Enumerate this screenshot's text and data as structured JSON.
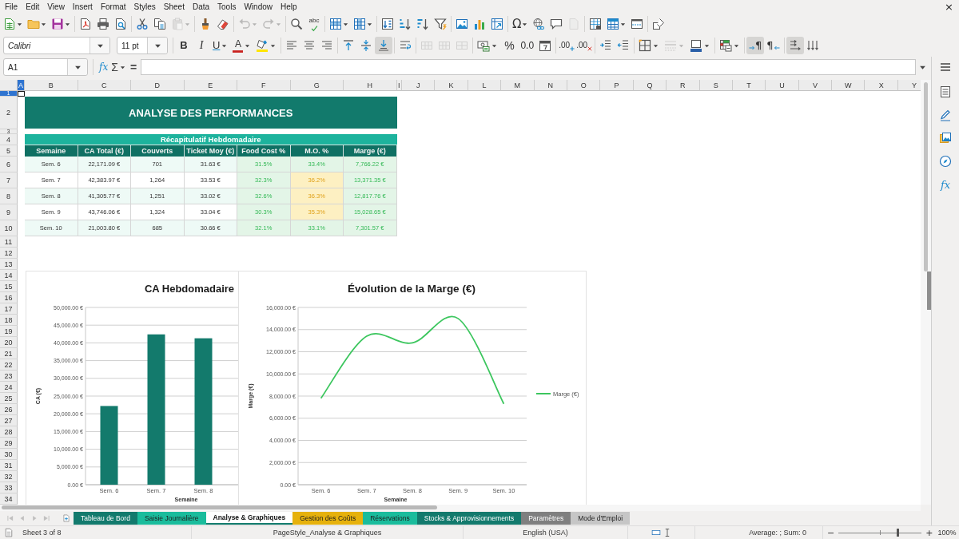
{
  "menu_bar": {
    "items": [
      "File",
      "Edit",
      "View",
      "Insert",
      "Format",
      "Styles",
      "Sheet",
      "Data",
      "Tools",
      "Window",
      "Help"
    ],
    "close_button": "×"
  },
  "standard_toolbar": {
    "groups": [
      [
        {
          "dropdown": true,
          "disabled": false
        },
        {
          "dropdown": true,
          "disabled": false
        },
        {
          "dropdown": true,
          "disabled": false
        }
      ],
      [
        {
          "dropdown": false,
          "disabled": false
        },
        {
          "dropdown": false,
          "disabled": false
        },
        {
          "dropdown": false,
          "disabled": false
        }
      ],
      [
        {
          "dropdown": false,
          "disabled": false
        },
        {
          "dropdown": false,
          "disabled": false
        },
        {
          "dropdown": true,
          "disabled": true
        }
      ],
      [
        {
          "dropdown": false,
          "disabled": false
        },
        {
          "dropdown": false,
          "disabled": false
        }
      ],
      [
        {
          "dropdown": true,
          "disabled": true
        },
        {
          "dropdown": true,
          "disabled": true
        }
      ],
      [
        {
          "dropdown": false,
          "disabled": false
        },
        {
          "label": "abc",
          "dropdown": false,
          "disabled": false
        }
      ],
      [
        {
          "dropdown": true,
          "disabled": false
        },
        {
          "dropdown": true,
          "disabled": false
        }
      ],
      [
        {
          "dropdown": false,
          "disabled": false
        },
        {
          "dropdown": false,
          "disabled": false
        },
        {
          "dropdown": false,
          "disabled": false
        },
        {
          "dropdown": false,
          "disabled": false
        }
      ],
      [
        {
          "dropdown": false,
          "disabled": false
        },
        {
          "dropdown": false,
          "disabled": false
        },
        {
          "dropdown": false,
          "disabled": false
        }
      ],
      [
        {
          "label": "Ω",
          "dropdown": true,
          "disabled": false
        },
        {
          "dropdown": false,
          "disabled": false
        },
        {
          "dropdown": false,
          "disabled": false
        },
        {
          "dropdown": false,
          "disabled": true
        }
      ],
      [
        {
          "dropdown": false,
          "disabled": false
        },
        {
          "dropdown": true,
          "disabled": false
        },
        {
          "dropdown": false,
          "disabled": false
        }
      ],
      [
        {
          "dropdown": false,
          "disabled": false
        }
      ]
    ]
  },
  "formatting_toolbar": {
    "font_name": "Calibri",
    "font_size": "11 pt",
    "groups": [
      [
        {
          "label": "B",
          "dropdown": false,
          "disabled": false,
          "pressed": false
        },
        {
          "label": "I",
          "dropdown": false,
          "disabled": false,
          "pressed": false
        },
        {
          "label": "U",
          "dropdown": true,
          "disabled": false,
          "pressed": false
        },
        {
          "label": "A",
          "dropdown": true,
          "disabled": false,
          "pressed": false
        },
        {
          "dropdown": true,
          "disabled": false,
          "pressed": false
        }
      ],
      [
        {
          "dropdown": false,
          "disabled": false,
          "pressed": false
        },
        {
          "dropdown": false,
          "disabled": false,
          "pressed": false
        },
        {
          "dropdown": false,
          "disabled": false,
          "pressed": false
        }
      ],
      [
        {
          "dropdown": false,
          "disabled": false,
          "pressed": false
        },
        {
          "dropdown": false,
          "disabled": false,
          "pressed": false
        },
        {
          "dropdown": false,
          "disabled": false,
          "pressed": true
        }
      ],
      [
        {
          "dropdown": false,
          "disabled": false,
          "pressed": false
        }
      ],
      [
        {
          "dropdown": false,
          "disabled": true,
          "pressed": false
        },
        {
          "dropdown": false,
          "disabled": true,
          "pressed": false
        },
        {
          "dropdown": false,
          "disabled": true,
          "pressed": false
        }
      ],
      [
        {
          "dropdown": true,
          "disabled": false,
          "pressed": false
        },
        {
          "label": "%",
          "dropdown": false,
          "disabled": false,
          "pressed": false
        },
        {
          "label": "0.0",
          "dropdown": false,
          "disabled": false,
          "pressed": false
        },
        {
          "dropdown": false,
          "disabled": false,
          "pressed": false
        }
      ],
      [
        {
          "label": ".00",
          "dropdown": false,
          "disabled": false,
          "pressed": false
        },
        {
          "label": ".00",
          "dropdown": false,
          "disabled": false,
          "pressed": false
        }
      ],
      [
        {
          "dropdown": false,
          "disabled": false,
          "pressed": false
        },
        {
          "dropdown": false,
          "disabled": false,
          "pressed": false
        }
      ],
      [
        {
          "dropdown": true,
          "disabled": false,
          "pressed": false
        },
        {
          "dropdown": true,
          "disabled": true,
          "pressed": false
        },
        {
          "dropdown": true,
          "disabled": false,
          "pressed": false
        }
      ],
      [
        {
          "dropdown": true,
          "disabled": false,
          "pressed": false
        }
      ],
      [
        {
          "label": "¶",
          "dropdown": false,
          "disabled": false,
          "pressed": true
        },
        {
          "label": "¶",
          "dropdown": false,
          "disabled": false,
          "pressed": false
        }
      ],
      [
        {
          "dropdown": false,
          "disabled": false,
          "pressed": true
        },
        {
          "dropdown": false,
          "disabled": false,
          "pressed": false
        }
      ]
    ]
  },
  "formula_bar": {
    "name_box": "A1",
    "function_wizard": "fx",
    "sum": "Σ",
    "equals": "="
  },
  "sheet": {
    "columns": [
      {
        "label": "A",
        "selected": true
      },
      {
        "label": "B",
        "selected": false
      },
      {
        "label": "C",
        "selected": false
      },
      {
        "label": "D",
        "selected": false
      },
      {
        "label": "E",
        "selected": false
      },
      {
        "label": "F",
        "selected": false
      },
      {
        "label": "G",
        "selected": false
      },
      {
        "label": "H",
        "selected": false
      },
      {
        "label": "I",
        "selected": false
      },
      {
        "label": "J",
        "selected": false
      },
      {
        "label": "K",
        "selected": false
      },
      {
        "label": "L",
        "selected": false
      },
      {
        "label": "M",
        "selected": false
      },
      {
        "label": "N",
        "selected": false
      },
      {
        "label": "O",
        "selected": false
      },
      {
        "label": "P",
        "selected": false
      },
      {
        "label": "Q",
        "selected": false
      },
      {
        "label": "R",
        "selected": false
      },
      {
        "label": "S",
        "selected": false
      },
      {
        "label": "T",
        "selected": false
      },
      {
        "label": "U",
        "selected": false
      },
      {
        "label": "V",
        "selected": false
      },
      {
        "label": "W",
        "selected": false
      },
      {
        "label": "X",
        "selected": false
      },
      {
        "label": "Y",
        "selected": false
      }
    ],
    "rows": [
      {
        "label": "1",
        "selected": true
      },
      {
        "label": "2",
        "selected": false
      },
      {
        "label": "3",
        "selected": false
      },
      {
        "label": "4",
        "selected": false
      },
      {
        "label": "5",
        "selected": false
      },
      {
        "label": "6",
        "selected": false
      },
      {
        "label": "7",
        "selected": false
      },
      {
        "label": "8",
        "selected": false
      },
      {
        "label": "9",
        "selected": false
      },
      {
        "label": "10",
        "selected": false
      },
      {
        "label": "11",
        "selected": false
      },
      {
        "label": "12",
        "selected": false
      },
      {
        "label": "13",
        "selected": false
      },
      {
        "label": "14",
        "selected": false
      },
      {
        "label": "15",
        "selected": false
      },
      {
        "label": "16",
        "selected": false
      },
      {
        "label": "17",
        "selected": false
      },
      {
        "label": "18",
        "selected": false
      },
      {
        "label": "19",
        "selected": false
      },
      {
        "label": "20",
        "selected": false
      },
      {
        "label": "21",
        "selected": false
      },
      {
        "label": "22",
        "selected": false
      },
      {
        "label": "23",
        "selected": false
      },
      {
        "label": "24",
        "selected": false
      },
      {
        "label": "25",
        "selected": false
      },
      {
        "label": "26",
        "selected": false
      },
      {
        "label": "27",
        "selected": false
      },
      {
        "label": "28",
        "selected": false
      },
      {
        "label": "29",
        "selected": false
      },
      {
        "label": "30",
        "selected": false
      },
      {
        "label": "31",
        "selected": false
      },
      {
        "label": "32",
        "selected": false
      },
      {
        "label": "33",
        "selected": false
      },
      {
        "label": "34",
        "selected": false
      }
    ],
    "title": "ANALYSE DES PERFORMANCES",
    "summary": {
      "caption": "Récapitulatif Hebdomadaire",
      "columns": [
        "Semaine",
        "CA Total (€)",
        "Couverts",
        "Ticket Moy (€)",
        "Food Cost %",
        "M.O. %",
        "Marge (€)"
      ],
      "rows": [
        {
          "cells": [
            "Sem. 6",
            "22,171.09 €",
            "701",
            "31.63 €"
          ],
          "indicators": [
            {
              "text": "31.5%",
              "warning": false
            },
            {
              "text": "33.4%",
              "warning": false
            },
            {
              "text": "7,766.22 €",
              "warning": false
            }
          ]
        },
        {
          "cells": [
            "Sem. 7",
            "42,383.97 €",
            "1,264",
            "33.53 €"
          ],
          "indicators": [
            {
              "text": "32.3%",
              "warning": false
            },
            {
              "text": "36.2%",
              "warning": true
            },
            {
              "text": "13,371.35 €",
              "warning": false
            }
          ]
        },
        {
          "cells": [
            "Sem. 8",
            "41,305.77 €",
            "1,251",
            "33.02 €"
          ],
          "indicators": [
            {
              "text": "32.6%",
              "warning": false
            },
            {
              "text": "36.3%",
              "warning": true
            },
            {
              "text": "12,817.76 €",
              "warning": false
            }
          ]
        },
        {
          "cells": [
            "Sem. 9",
            "43,746.06 €",
            "1,324",
            "33.04 €"
          ],
          "indicators": [
            {
              "text": "30.3%",
              "warning": false
            },
            {
              "text": "35.3%",
              "warning": true
            },
            {
              "text": "15,028.65 €",
              "warning": false
            }
          ]
        },
        {
          "cells": [
            "Sem. 10",
            "21,003.80 €",
            "685",
            "30.66 €"
          ],
          "indicators": [
            {
              "text": "32.1%",
              "warning": false
            },
            {
              "text": "33.1%",
              "warning": false
            },
            {
              "text": "7,301.57 €",
              "warning": false
            }
          ]
        }
      ]
    },
    "charts": [
      {
        "chart_data": {
          "type": "bar",
          "title": "CA Hebdomadaire",
          "xlabel": "Semaine",
          "ylabel": "CA (€)",
          "grid": true,
          "categories": [
            "Sem. 6",
            "Sem. 7",
            "Sem. 8"
          ],
          "values": [
            22200,
            42400,
            41300
          ],
          "ylim": [
            0,
            50000
          ],
          "yticks": [
            {
              "value": 0,
              "label": "0.00 €"
            },
            {
              "value": 5000,
              "label": "5,000.00 €"
            },
            {
              "value": 10000,
              "label": "10,000.00 €"
            },
            {
              "value": 15000,
              "label": "15,000.00 €"
            },
            {
              "value": 20000,
              "label": "20,000.00 €"
            },
            {
              "value": 25000,
              "label": "25,000.00 €"
            },
            {
              "value": 30000,
              "label": "30,000.00 €"
            },
            {
              "value": 35000,
              "label": "35,000.00 €"
            },
            {
              "value": 40000,
              "label": "40,000.00 €"
            },
            {
              "value": 45000,
              "label": "45,000.00 €"
            },
            {
              "value": 50000,
              "label": "50,000.00 €"
            }
          ]
        }
      },
      {
        "chart_data": {
          "type": "line",
          "title": "Évolution de la Marge (€)",
          "xlabel": "Semaine",
          "ylabel": "Marge (€)",
          "grid": true,
          "categories": [
            "Sem. 6",
            "Sem. 7",
            "Sem. 8",
            "Sem. 9",
            "Sem. 10"
          ],
          "series": [
            {
              "name": "Marge (€)",
              "color": "#3cc65e",
              "values": [
                7800,
                13400,
                12800,
                15000,
                7300
              ]
            }
          ],
          "ylim": [
            0,
            16000
          ],
          "yticks": [
            {
              "value": 0,
              "label": "0.00 €"
            },
            {
              "value": 2000,
              "label": "2,000.00 €"
            },
            {
              "value": 4000,
              "label": "4,000.00 €"
            },
            {
              "value": 6000,
              "label": "6,000.00 €"
            },
            {
              "value": 8000,
              "label": "8,000.00 €"
            },
            {
              "value": 10000,
              "label": "10,000.00 €"
            },
            {
              "value": 12000,
              "label": "12,000.00 €"
            },
            {
              "value": 14000,
              "label": "14,000.00 €"
            },
            {
              "value": 16000,
              "label": "16,000.00 €"
            }
          ]
        }
      }
    ]
  },
  "sheet_tabs": {
    "navigation": [
      {
        "disabled": true
      },
      {
        "disabled": true
      },
      {
        "disabled": true
      },
      {
        "disabled": true
      }
    ],
    "tabs": [
      {
        "label": "Tableau de Bord",
        "color": "#137a6d",
        "selected": false
      },
      {
        "label": "Saisie Journalière",
        "color": "#1abc9c",
        "selected": false
      },
      {
        "label": "Analyse & Graphiques",
        "selected": true
      },
      {
        "label": "Gestion des Coûts",
        "color": "#e6b10c",
        "selected": false
      },
      {
        "label": "Réservations",
        "color": "#1abc9c",
        "selected": false
      },
      {
        "label": "Stocks & Approvisionnements",
        "color": "#137a6d",
        "selected": false
      },
      {
        "label": "Paramètres",
        "color": "#7f7f7f",
        "selected": false
      },
      {
        "label": "Mode d'Emploi",
        "color": "#c6c6c6",
        "selected": false
      }
    ]
  },
  "sidebar": {
    "function_button": "fx"
  },
  "status_bar": {
    "sheet": "Sheet 3 of 8",
    "page_style": "PageStyle_Analyse & Graphiques",
    "language": "English (USA)",
    "summary": "Average: ; Sum: 0",
    "zoom_out": "−",
    "zoom_in": "+",
    "zoom": {
      "level": 0.71,
      "reading": "100%"
    }
  }
}
